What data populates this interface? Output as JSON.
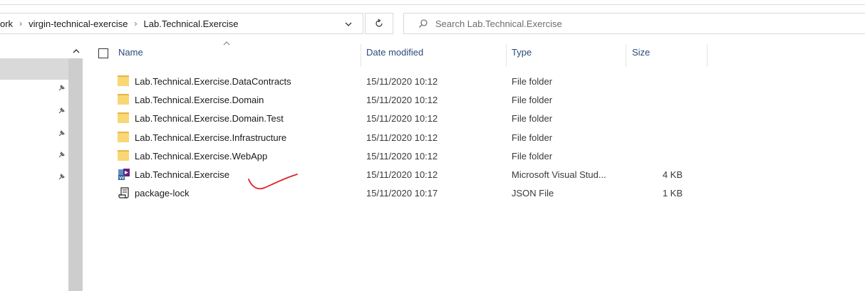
{
  "breadcrumb": [
    {
      "label": "ork"
    },
    {
      "label": "virgin-technical-exercise"
    },
    {
      "label": "Lab.Technical.Exercise"
    }
  ],
  "search": {
    "placeholder": "Search Lab.Technical.Exercise"
  },
  "columns": {
    "name": "Name",
    "date": "Date modified",
    "type": "Type",
    "size": "Size"
  },
  "files": [
    {
      "name": "Lab.Technical.Exercise.DataContracts",
      "date": "15/11/2020 10:12",
      "type": "File folder",
      "size": "",
      "icon": "folder-icon"
    },
    {
      "name": "Lab.Technical.Exercise.Domain",
      "date": "15/11/2020 10:12",
      "type": "File folder",
      "size": "",
      "icon": "folder-icon"
    },
    {
      "name": "Lab.Technical.Exercise.Domain.Test",
      "date": "15/11/2020 10:12",
      "type": "File folder",
      "size": "",
      "icon": "folder-icon"
    },
    {
      "name": "Lab.Technical.Exercise.Infrastructure",
      "date": "15/11/2020 10:12",
      "type": "File folder",
      "size": "",
      "icon": "folder-icon"
    },
    {
      "name": "Lab.Technical.Exercise.WebApp",
      "date": "15/11/2020 10:12",
      "type": "File folder",
      "size": "",
      "icon": "folder-icon"
    },
    {
      "name": "Lab.Technical.Exercise",
      "date": "15/11/2020 10:12",
      "type": "Microsoft Visual Stud...",
      "size": "4 KB",
      "icon": "visual-studio-solution-icon"
    },
    {
      "name": "package-lock",
      "date": "15/11/2020 10:17",
      "type": "JSON File",
      "size": "1 KB",
      "icon": "json-file-icon"
    }
  ],
  "colors": {
    "header_text": "#2b4a7a",
    "folder": "#f8d775",
    "annotation": "#e0202a",
    "vs_purple": "#68217a"
  }
}
